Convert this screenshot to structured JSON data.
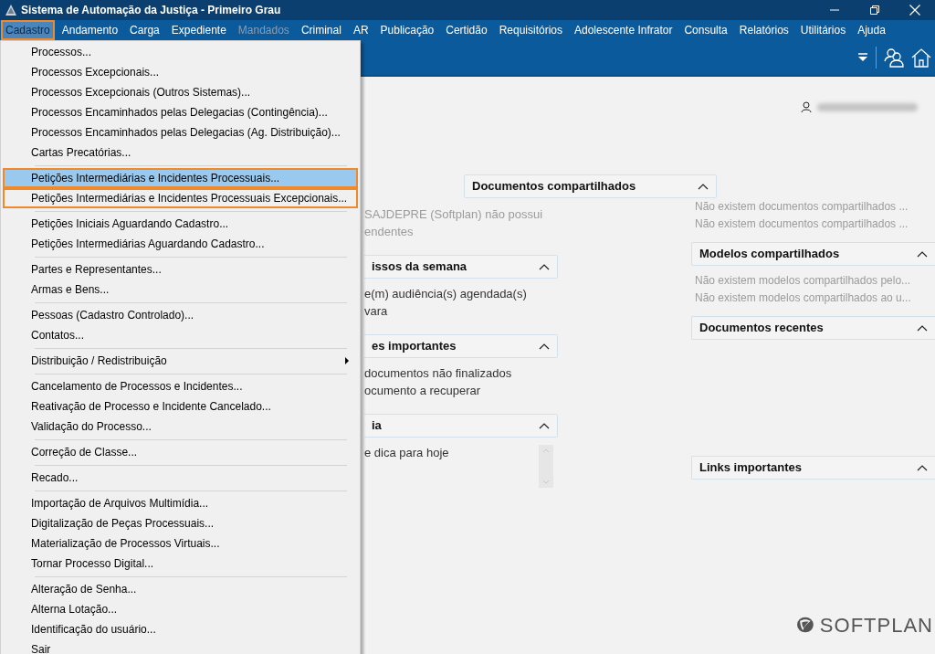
{
  "window": {
    "title": "Sistema de Automação da Justiça - Primeiro Grau"
  },
  "menubar": [
    {
      "label": "Cadastro",
      "selected": true,
      "outlined": true,
      "disabled": false
    },
    {
      "label": "Andamento",
      "selected": false,
      "outlined": false,
      "disabled": false
    },
    {
      "label": "Carga",
      "selected": false,
      "outlined": false,
      "disabled": false
    },
    {
      "label": "Expediente",
      "selected": false,
      "outlined": false,
      "disabled": false
    },
    {
      "label": "Mandados",
      "selected": false,
      "outlined": false,
      "disabled": true
    },
    {
      "label": "Criminal",
      "selected": false,
      "outlined": false,
      "disabled": false
    },
    {
      "label": "AR",
      "selected": false,
      "outlined": false,
      "disabled": false
    },
    {
      "label": "Publicação",
      "selected": false,
      "outlined": false,
      "disabled": false
    },
    {
      "label": "Certidão",
      "selected": false,
      "outlined": false,
      "disabled": false
    },
    {
      "label": "Requisitórios",
      "selected": false,
      "outlined": false,
      "disabled": false
    },
    {
      "label": "Adolescente Infrator",
      "selected": false,
      "outlined": false,
      "disabled": false
    },
    {
      "label": "Consulta",
      "selected": false,
      "outlined": false,
      "disabled": false
    },
    {
      "label": "Relatórios",
      "selected": false,
      "outlined": false,
      "disabled": false
    },
    {
      "label": "Utilitários",
      "selected": false,
      "outlined": false,
      "disabled": false
    },
    {
      "label": "Ajuda",
      "selected": false,
      "outlined": false,
      "disabled": false
    }
  ],
  "dropdown": {
    "groups": [
      [
        {
          "label": "Processos...",
          "kind": "item",
          "selected": false,
          "outlined": false
        },
        {
          "label": "Processos Excepcionais...",
          "kind": "item",
          "selected": false,
          "outlined": false
        },
        {
          "label": "Processos Excepcionais (Outros Sistemas)...",
          "kind": "item",
          "selected": false,
          "outlined": false
        },
        {
          "label": "Processos Encaminhados pelas Delegacias (Contingência)...",
          "kind": "item",
          "selected": false,
          "outlined": false
        },
        {
          "label": "Processos Encaminhados pelas Delegacias (Ag. Distribuição)...",
          "kind": "item",
          "selected": false,
          "outlined": false
        },
        {
          "label": "Cartas Precatórias...",
          "kind": "item",
          "selected": false,
          "outlined": false
        }
      ],
      [
        {
          "label": "Petições Intermediárias e Incidentes Processuais...",
          "kind": "item",
          "selected": true,
          "outlined": true
        },
        {
          "label": "Petições Intermediárias e Incidentes Processuais Excepcionais...",
          "kind": "item",
          "selected": false,
          "outlined": true
        }
      ],
      [
        {
          "label": "Petições Iniciais Aguardando Cadastro...",
          "kind": "item",
          "selected": false,
          "outlined": false
        },
        {
          "label": "Petições Intermediárias Aguardando Cadastro...",
          "kind": "item",
          "selected": false,
          "outlined": false
        }
      ],
      [
        {
          "label": "Partes e Representantes...",
          "kind": "item",
          "selected": false,
          "outlined": false
        },
        {
          "label": "Armas e Bens...",
          "kind": "item",
          "selected": false,
          "outlined": false
        }
      ],
      [
        {
          "label": "Pessoas (Cadastro Controlado)...",
          "kind": "item",
          "selected": false,
          "outlined": false
        },
        {
          "label": "Contatos...",
          "kind": "item",
          "selected": false,
          "outlined": false
        }
      ],
      [
        {
          "label": "Distribuição / Redistribuição",
          "kind": "submenu",
          "selected": false,
          "outlined": false
        }
      ],
      [
        {
          "label": "Cancelamento de Processos e Incidentes...",
          "kind": "item",
          "selected": false,
          "outlined": false
        },
        {
          "label": "Reativação de Processo e Incidente Cancelado...",
          "kind": "item",
          "selected": false,
          "outlined": false
        },
        {
          "label": "Validação do Processo...",
          "kind": "item",
          "selected": false,
          "outlined": false
        }
      ],
      [
        {
          "label": "Correção de Classe...",
          "kind": "item",
          "selected": false,
          "outlined": false
        }
      ],
      [
        {
          "label": "Recado...",
          "kind": "item",
          "selected": false,
          "outlined": false
        }
      ],
      [
        {
          "label": "Importação de Arquivos Multimídia...",
          "kind": "item",
          "selected": false,
          "outlined": false
        },
        {
          "label": "Digitalização de Peças Processuais...",
          "kind": "item",
          "selected": false,
          "outlined": false
        },
        {
          "label": "Materialização de Processos Virtuais...",
          "kind": "item",
          "selected": false,
          "outlined": false
        },
        {
          "label": "Tornar Processo Digital...",
          "kind": "item",
          "selected": false,
          "outlined": false
        }
      ],
      [
        {
          "label": "Alteração de Senha...",
          "kind": "item",
          "selected": false,
          "outlined": false
        },
        {
          "label": "Alterna Lotação...",
          "kind": "item",
          "selected": false,
          "outlined": false
        },
        {
          "label": "Identificação do usuário...",
          "kind": "item",
          "selected": false,
          "outlined": false
        },
        {
          "label": "Sair",
          "kind": "item",
          "selected": false,
          "outlined": false
        }
      ]
    ]
  },
  "dashboard": {
    "center_header": "Documentos compartilhados",
    "left_sections": [
      {
        "lines": [
          {
            "text": "SAJDEPRE (Softplan) não possui",
            "muted": true
          },
          {
            "text": "endentes",
            "muted": true
          }
        ]
      },
      {
        "title": "issos da semana",
        "lines": [
          {
            "text": "e(m) audiência(s) agendada(s)",
            "muted": false
          },
          {
            "text": "vara",
            "muted": false
          }
        ]
      },
      {
        "title": "es importantes",
        "lines": [
          {
            "text": "documentos não finalizados",
            "muted": false
          },
          {
            "text": "ocumento a recuperar",
            "muted": false
          }
        ]
      },
      {
        "title": "ia",
        "scrollable": true,
        "lines": [
          {
            "text": "e dica para hoje",
            "muted": false
          }
        ]
      }
    ],
    "right_sections": [
      {
        "lines": [
          {
            "text": "Não existem documentos compartilhados ...",
            "muted": true
          },
          {
            "text": "Não existem documentos compartilhados ...",
            "muted": true
          }
        ]
      },
      {
        "title": "Modelos compartilhados",
        "lines": [
          {
            "text": "Não existem modelos compartilhados pelo...",
            "muted": true
          },
          {
            "text": "Não existem modelos compartilhados ao u...",
            "muted": true
          }
        ]
      },
      {
        "title": "Documentos recentes"
      },
      {
        "title": "Links importantes"
      }
    ],
    "logo": "SOFTPLAN"
  }
}
